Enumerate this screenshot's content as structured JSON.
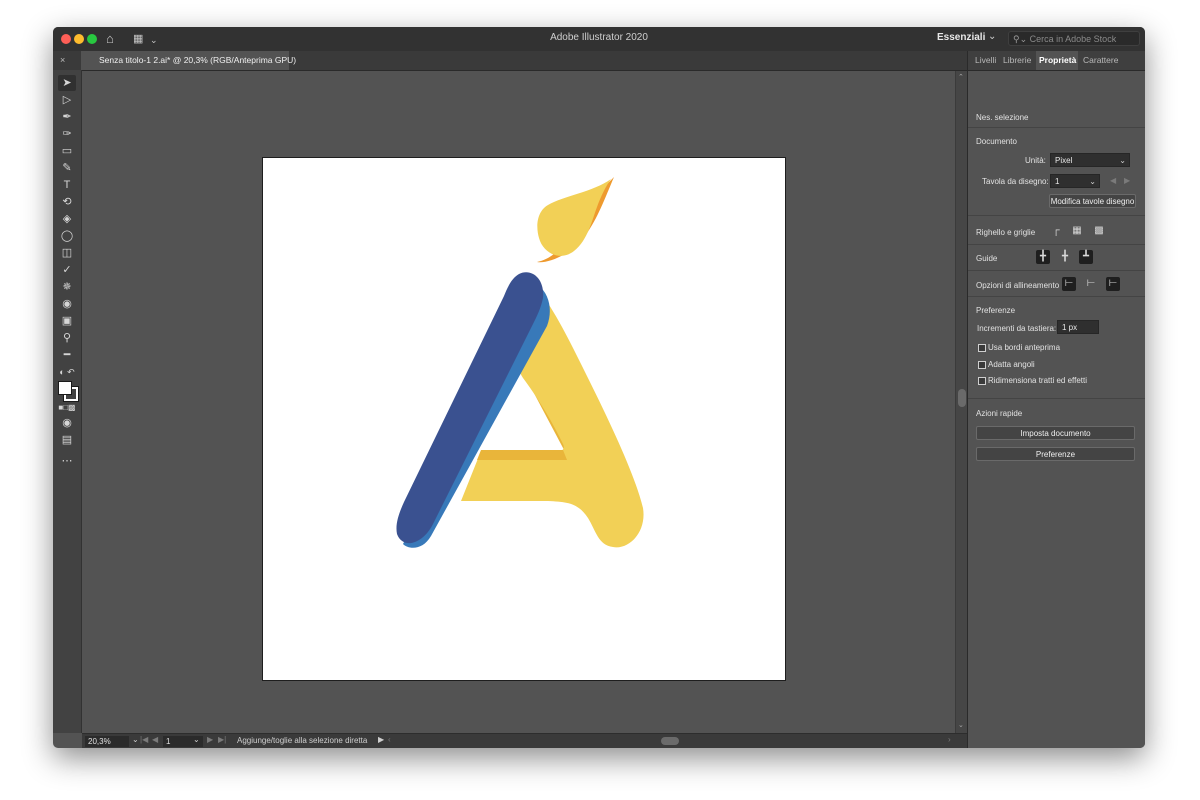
{
  "titlebar": {
    "title": "Adobe Illustrator 2020",
    "workspace": "Essenziali",
    "stock_search_placeholder": "Cerca in Adobe Stock"
  },
  "document_tab": {
    "name": "Senza titolo-1 2.ai* @ 20,3% (RGB/Anteprima GPU)"
  },
  "panel": {
    "tabs": [
      "Livelli",
      "Librerie",
      "Proprietà",
      "Carattere"
    ],
    "active_tab": "Proprietà",
    "no_selection": "Nes. selezione",
    "document_section": "Documento",
    "units_label": "Unità:",
    "units_value": "Pixel",
    "artboard_label": "Tavola da disegno:",
    "artboard_value": "1",
    "edit_artboards_button": "Modifica tavole disegno",
    "rulers_label": "Righello e griglie",
    "guides_label": "Guide",
    "align_label": "Opzioni di allineamento",
    "preferences_section": "Preferenze",
    "keyboard_increment_label": "Incrementi da tastiera:",
    "keyboard_increment_value": "1 px",
    "checkboxes": [
      "Usa bordi anteprima",
      "Adatta angoli",
      "Ridimensiona tratti ed effetti"
    ],
    "quick_actions_section": "Azioni rapide",
    "document_setup_button": "Imposta documento",
    "preferences_button": "Preferenze"
  },
  "statusbar": {
    "zoom": "20,3%",
    "page": "1",
    "status_text": "Aggiunge/toglie alla selezione diretta"
  },
  "artwork": {
    "colors": {
      "blue": "#3a5190",
      "blue_shadow": "#3879b9",
      "yellow": "#f2d056",
      "yellow_shadow": "#e9b53a",
      "orange": "#ee9a2e"
    }
  }
}
